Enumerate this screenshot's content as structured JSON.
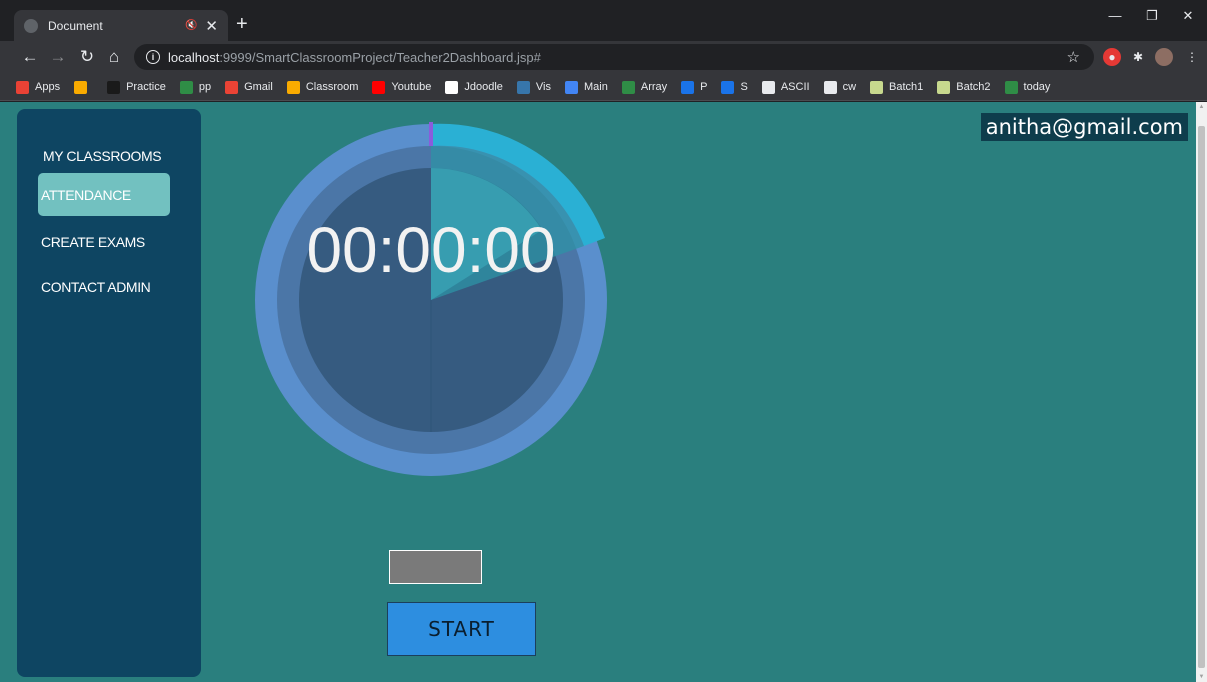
{
  "browser": {
    "tab_title": "Document",
    "new_tab_label": "+",
    "url_host": "localhost",
    "url_path": ":9999/SmartClassroomProject/Teacher2Dashboard.jsp#",
    "bookmarks": [
      {
        "label": "Apps",
        "icon": "apps-grid-icon",
        "color": "#e94235"
      },
      {
        "label": "",
        "icon": "folder-icon",
        "color": "#f9ab00"
      },
      {
        "label": "Practice",
        "icon": "practice-icon",
        "color": "#1a1a1a"
      },
      {
        "label": "pp",
        "icon": "gfg-icon",
        "color": "#2f8d46"
      },
      {
        "label": "Gmail",
        "icon": "gmail-icon",
        "color": "#ea4335"
      },
      {
        "label": "Classroom",
        "icon": "classroom-icon",
        "color": "#f9ab00"
      },
      {
        "label": "Youtube",
        "icon": "youtube-icon",
        "color": "#ff0000"
      },
      {
        "label": "Jdoodle",
        "icon": "jdoodle-icon",
        "color": "#ffffff"
      },
      {
        "label": "Vis",
        "icon": "python-icon",
        "color": "#3776ab"
      },
      {
        "label": "Main",
        "icon": "docs-icon",
        "color": "#4285f4"
      },
      {
        "label": "Array",
        "icon": "gfg-icon",
        "color": "#2f8d46"
      },
      {
        "label": "P",
        "icon": "s-icon",
        "color": "#1a73e8"
      },
      {
        "label": "S",
        "icon": "s-icon",
        "color": "#1a73e8"
      },
      {
        "label": "ASCII",
        "icon": "globe-icon",
        "color": "#e8eaed"
      },
      {
        "label": "cw",
        "icon": "globe-icon",
        "color": "#e8eaed"
      },
      {
        "label": "Batch1",
        "icon": "sheets-icon",
        "color": "#c7d98e"
      },
      {
        "label": "Batch2",
        "icon": "sheets-icon",
        "color": "#c7d98e"
      },
      {
        "label": "today",
        "icon": "gfg-icon",
        "color": "#2f8d46"
      }
    ]
  },
  "sidebar": {
    "items": [
      {
        "label": "MY CLASSROOMS",
        "active": false
      },
      {
        "label": "ATTENDANCE",
        "active": true
      },
      {
        "label": "CREATE EXAMS",
        "active": false
      },
      {
        "label": "CONTACT ADMIN",
        "active": false
      }
    ]
  },
  "header": {
    "user_email": "anitha@gmail.com"
  },
  "timer": {
    "display": "00:00:00"
  },
  "controls": {
    "start_label": "START",
    "input_value": ""
  },
  "colors": {
    "page_bg": "#2a7f7e",
    "sidebar_bg": "#0e4562",
    "active_item": "#72c1c0",
    "start_button": "#2d8ee0"
  }
}
